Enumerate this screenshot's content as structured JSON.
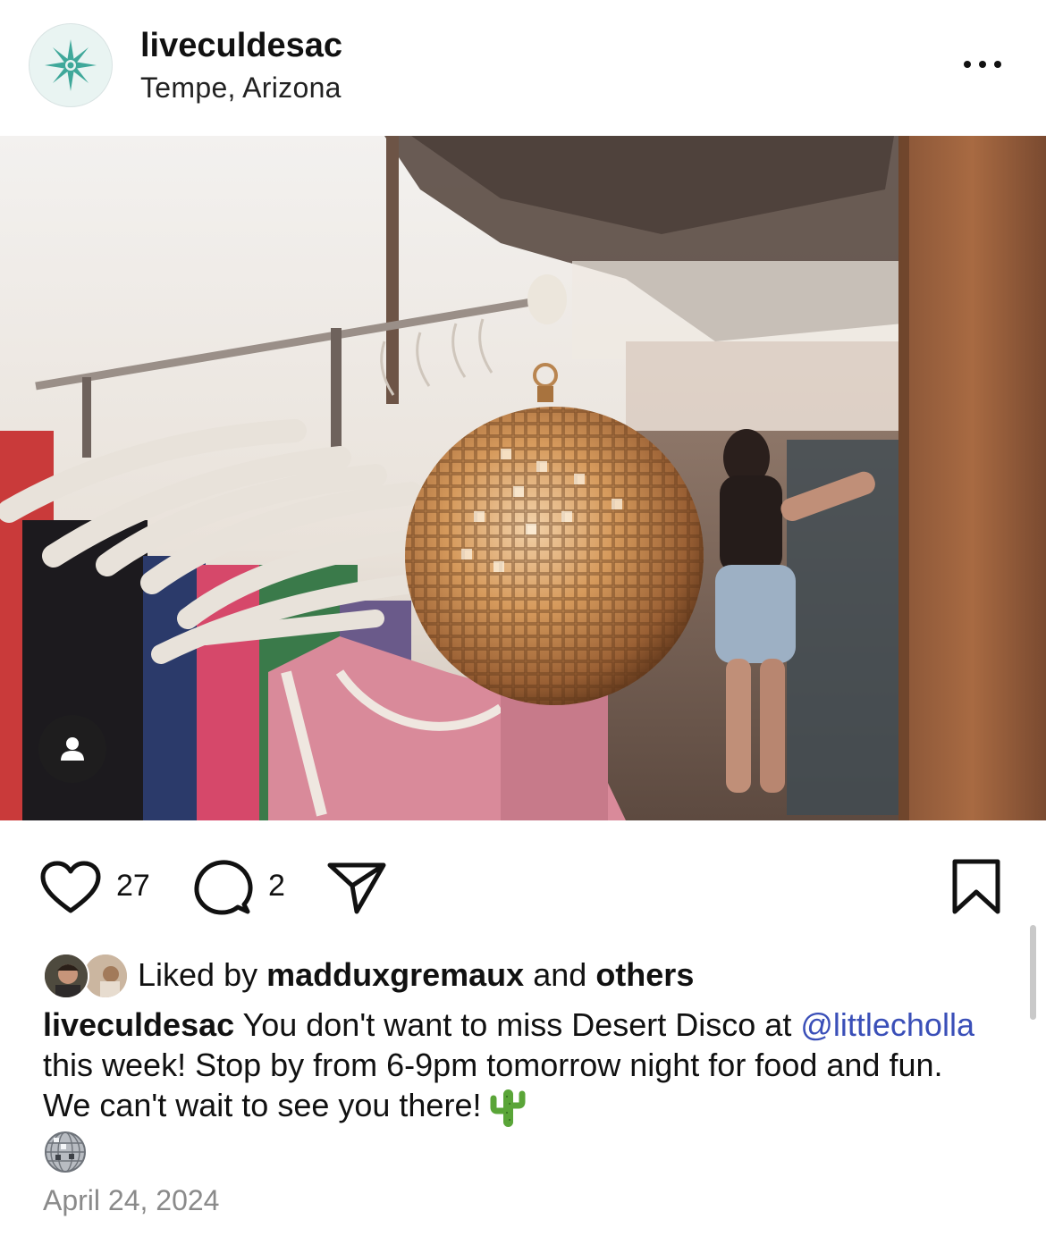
{
  "header": {
    "username": "liveculdesac",
    "location": "Tempe, Arizona"
  },
  "actions": {
    "like_count": "27",
    "comment_count": "2"
  },
  "likes": {
    "prefix": "Liked by",
    "user": "madduxgremaux",
    "connector": "and",
    "others": "others"
  },
  "caption": {
    "username": "liveculdesac",
    "text_1": "You don't want to miss Desert Disco at",
    "mention": "@littlecholla",
    "text_2": "this week! Stop by from 6-9pm tomorrow night for food and fun. We can't wait to see you there!",
    "emoji_1": "cactus",
    "emoji_2": "disco-ball"
  },
  "date": "April 24, 2024",
  "colors": {
    "brand_teal": "#3fa89a",
    "mention_blue": "#3a4fb8",
    "date_gray": "#8a8a8a"
  }
}
